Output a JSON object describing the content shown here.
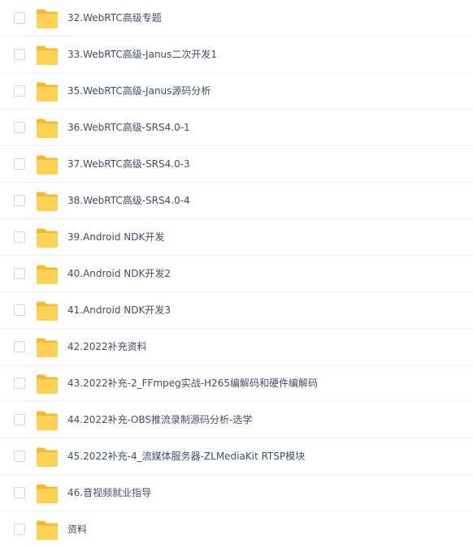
{
  "file_list": {
    "items": [
      {
        "name": "32.WebRTC高级专题",
        "icon": "folder-icon"
      },
      {
        "name": "33.WebRTC高级-Janus二次开发1",
        "icon": "folder-icon"
      },
      {
        "name": "35.WebRTC高级-Janus源码分析",
        "icon": "folder-icon"
      },
      {
        "name": "36.WebRTC高级-SRS4.0-1",
        "icon": "folder-icon"
      },
      {
        "name": "37.WebRTC高级-SRS4.0-3",
        "icon": "folder-icon"
      },
      {
        "name": "38.WebRTC高级-SRS4.0-4",
        "icon": "folder-icon"
      },
      {
        "name": "39.Android NDK开发",
        "icon": "folder-icon"
      },
      {
        "name": "40.Android NDK开发2",
        "icon": "folder-icon"
      },
      {
        "name": "41.Android NDK开发3",
        "icon": "folder-icon"
      },
      {
        "name": "42.2022补充资料",
        "icon": "folder-icon"
      },
      {
        "name": "43.2022补充-2_FFmpeg实战-H265编解码和硬件编解码",
        "icon": "folder-icon"
      },
      {
        "name": "44.2022补充-OBS推流录制源码分析-选学",
        "icon": "folder-icon"
      },
      {
        "name": "45.2022补充-4_流媒体服务器-ZLMediaKit RTSP模块",
        "icon": "folder-icon"
      },
      {
        "name": "46.音视频就业指导",
        "icon": "folder-icon"
      },
      {
        "name": "资料",
        "icon": "folder-icon"
      }
    ]
  },
  "colors": {
    "folder_back": "#f5b92e",
    "folder_front": "#fdd154",
    "text": "#424e67",
    "divider": "#eef0f4",
    "checkbox_border": "#d4d8de"
  }
}
